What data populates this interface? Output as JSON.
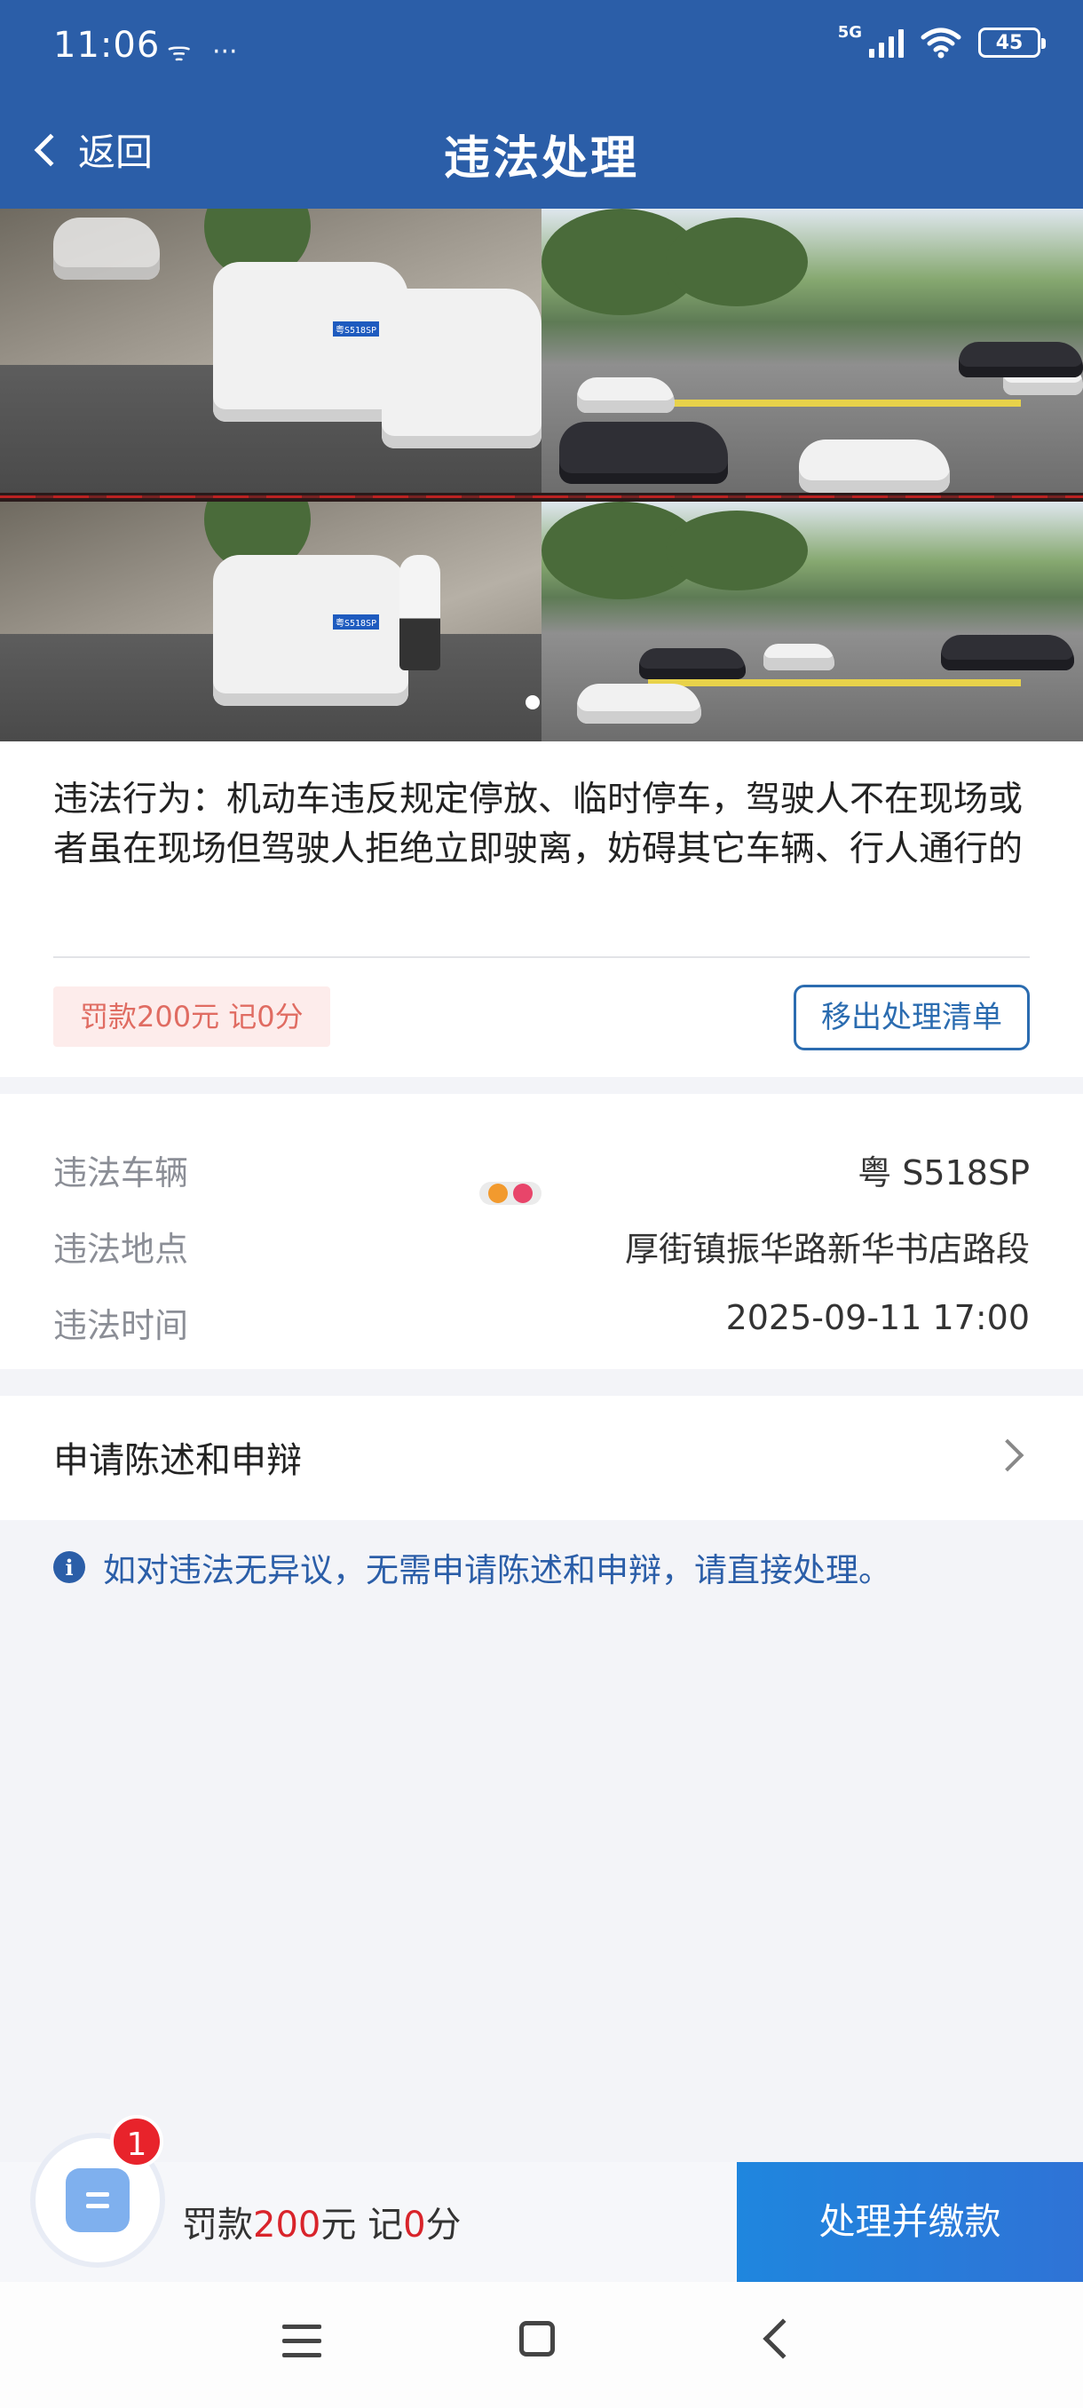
{
  "status_bar": {
    "time": "11:06",
    "left_icons": [
      "notification-icon",
      "more-dots-icon"
    ],
    "network": "5G",
    "battery": "45"
  },
  "nav": {
    "back_label": "返回",
    "title": "违法处理"
  },
  "photos": {
    "count": 4,
    "plate_text": "粤S518SP",
    "carousel_dots": 2,
    "active_dot": 1
  },
  "violation": {
    "description": "违法行为：机动车违反规定停放、临时停车，驾驶人不在现场或者虽在现场但驾驶人拒绝立即驶离，妨碍其它车辆、行人通行的",
    "fine_badge": "罚款200元 记0分",
    "remove_button": "移出处理清单"
  },
  "details": [
    {
      "label": "违法车辆",
      "value": "粤 S518SP"
    },
    {
      "label": "违法地点",
      "value": "厚街镇振华路新华书店路段"
    },
    {
      "label": "违法时间",
      "value": "2025-09-11 17:00"
    }
  ],
  "appeal": {
    "label": "申请陈述和申辩"
  },
  "notice": {
    "text": "如对违法无异议，无需申请陈述和申辩，请直接处理。"
  },
  "bottom": {
    "badge_count": "1",
    "fine_prefix": "罚款",
    "fine_amount": "200",
    "fine_unit": "元 记",
    "points": "0",
    "points_unit": "分",
    "pay_button": "处理并缴款"
  },
  "colors": {
    "primary": "#2b5ea8",
    "danger": "#d9242b",
    "pay_button": "#1f86de"
  }
}
